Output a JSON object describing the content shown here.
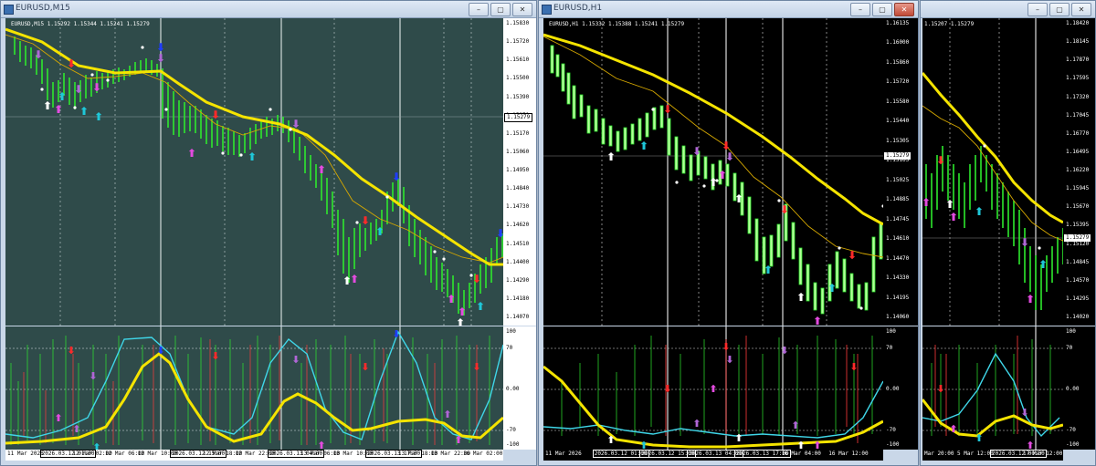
{
  "windows": [
    {
      "title": "EURUSD,M15",
      "symbol_line": "EURUSD,M15  1.15292 1.15344 1.15241 1.15279",
      "price_ticks": [
        "1.15830",
        "1.15720",
        "1.15610",
        "1.15500",
        "1.15390",
        "1.15279",
        "1.15170",
        "1.15060",
        "1.14950",
        "1.14840",
        "1.14730",
        "1.14620",
        "1.14510",
        "1.14400",
        "1.14290",
        "1.14180",
        "1.14070"
      ],
      "current_price": "1.15279",
      "osc_ticks": [
        "100",
        "70",
        "0.00",
        "-70",
        "-100"
      ],
      "time_labels": [
        "11 Mar 2026",
        "2026.03.12 01:00",
        "12 Mar 02:00",
        "12 Mar 06:00",
        "12 Mar 10:00",
        "2026.03.12 15:00",
        "12 Mar 18:00",
        "12 Mar 22:00",
        "2026.03.13 04:00",
        "13 Mar 06:00",
        "13 Mar 10:00",
        "2026.03.13 17:00",
        "13 Mar 18:00",
        "13 Mar 22:00",
        "16 Mar 02:00"
      ]
    },
    {
      "title": "EURUSD,H1",
      "symbol_line": "EURUSD,H1  1.15332 1.15388 1.15241 1.15279",
      "price_ticks": [
        "1.16135",
        "1.16000",
        "1.15860",
        "1.15720",
        "1.15580",
        "1.15440",
        "1.15305",
        "1.15165",
        "1.15025",
        "1.14885",
        "1.14745",
        "1.14610",
        "1.14470",
        "1.14330",
        "1.14195",
        "1.14060"
      ],
      "current_price": "1.15279",
      "osc_ticks": [
        "100",
        "70",
        "0.00",
        "-70",
        "-100"
      ],
      "time_labels": [
        "11 Mar 2026",
        "2026.03.12 01:00",
        "2026.03.12 15:00",
        "2026.03.13 04:00",
        "2026.03.13 17:00",
        "16 Mar 04:00",
        "16 Mar 12:00"
      ]
    },
    {
      "title": "",
      "symbol_line": "1.15207 1.15279",
      "price_ticks": [
        "1.18420",
        "1.18145",
        "1.17870",
        "1.17595",
        "1.17320",
        "1.17045",
        "1.16770",
        "1.16495",
        "1.16220",
        "1.15945",
        "1.15670",
        "1.15395",
        "1.15120",
        "1.14845",
        "1.14570",
        "1.14295",
        "1.14020"
      ],
      "current_price": "1.15279",
      "osc_ticks": [
        "100",
        "70",
        "0.00",
        "-70",
        "-100"
      ],
      "time_labels": [
        "Mar 20:00",
        "5 Mar 12:00",
        "2026.03.12 00:00",
        "17 Mar 12:00"
      ]
    }
  ],
  "controls": {
    "minimize": "–",
    "restore": "▢",
    "close": "✕"
  },
  "colors": {
    "bg_m15": "#2f4b4a",
    "bg_h1": "#000000",
    "candle_green": "#2ee82e",
    "ma_thick": "#f5e400",
    "ma_thin": "#d6a800",
    "arrow_red": "#ff2a2a",
    "arrow_blue": "#1f3cff",
    "arrow_magenta": "#e34be0",
    "arrow_cyan": "#1fc7d8",
    "arrow_white": "#ffffff",
    "arrow_violet": "#b066d6",
    "osc_cyan": "#3fd6e8"
  }
}
